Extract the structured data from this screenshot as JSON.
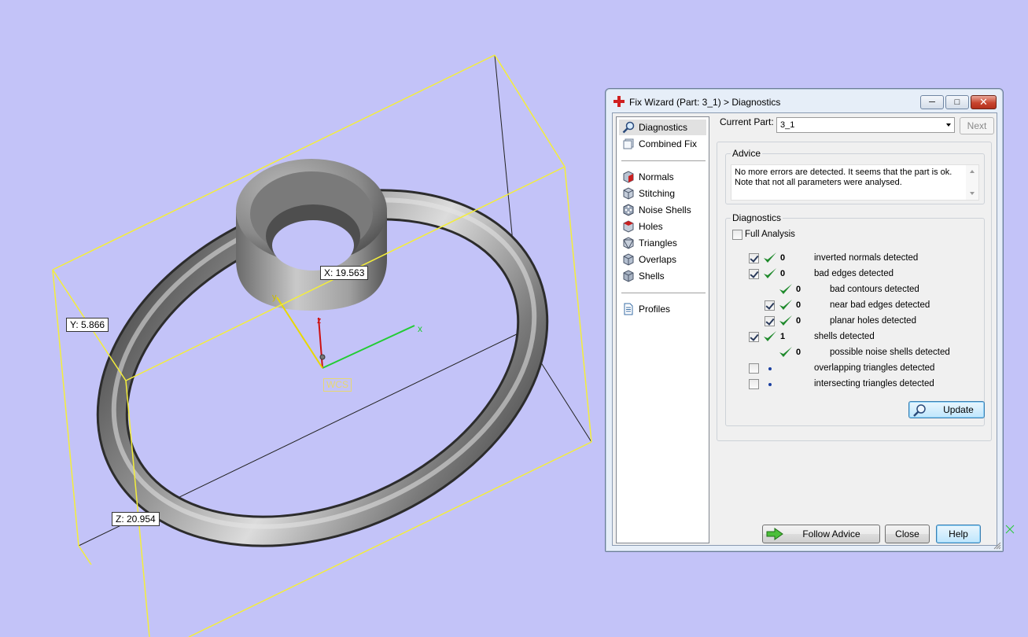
{
  "viewport": {
    "x_dim": "X: 19.563",
    "y_dim": "Y: 5.866",
    "z_dim": "Z: 20.954",
    "wcs_label": "WCS",
    "axis_x": "x",
    "axis_y": "y",
    "axis_z": "z"
  },
  "dialog": {
    "title": "Fix Wizard (Part: 3_1) > Diagnostics",
    "sidebar": {
      "items": [
        {
          "label": "Diagnostics",
          "icon": "magnifier-icon"
        },
        {
          "label": "Combined Fix",
          "icon": "layers-icon"
        },
        {
          "label": "Normals",
          "icon": "cube-red-icon"
        },
        {
          "label": "Stitching",
          "icon": "cube-stitch-icon"
        },
        {
          "label": "Noise Shells",
          "icon": "cube-dots-icon"
        },
        {
          "label": "Holes",
          "icon": "cube-hole-icon"
        },
        {
          "label": "Triangles",
          "icon": "cube-triangle-icon"
        },
        {
          "label": "Overlaps",
          "icon": "cube-overlap-icon"
        },
        {
          "label": "Shells",
          "icon": "cube-shell-icon"
        },
        {
          "label": "Profiles",
          "icon": "document-icon"
        }
      ]
    },
    "current_part_label": "Current Part:",
    "current_part_value": "3_1",
    "next_label": "Next",
    "advice": {
      "title": "Advice",
      "line1": "No more errors are detected. It seems that the part is ok.",
      "line2": "Note that not all parameters were analysed."
    },
    "diagnostics": {
      "title": "Diagnostics",
      "full_analysis_label": "Full Analysis",
      "rows": [
        {
          "count": "0",
          "text": "inverted normals detected"
        },
        {
          "count": "0",
          "text": "bad edges detected"
        },
        {
          "count": "0",
          "text": "bad contours detected"
        },
        {
          "count": "0",
          "text": "near bad edges detected"
        },
        {
          "count": "0",
          "text": "planar holes detected"
        },
        {
          "count": "1",
          "text": "shells detected"
        },
        {
          "count": "0",
          "text": "possible noise shells detected"
        },
        {
          "count": "",
          "text": "overlapping triangles detected"
        },
        {
          "count": "",
          "text": "intersecting triangles detected"
        }
      ],
      "update_label": "Update"
    },
    "buttons": {
      "follow_advice": "Follow Advice",
      "close": "Close",
      "help": "Help"
    }
  },
  "colors": {
    "background": "#c3c3f8",
    "bounding_box": "#f4ee3a",
    "check_green": "#1f8a2c"
  }
}
